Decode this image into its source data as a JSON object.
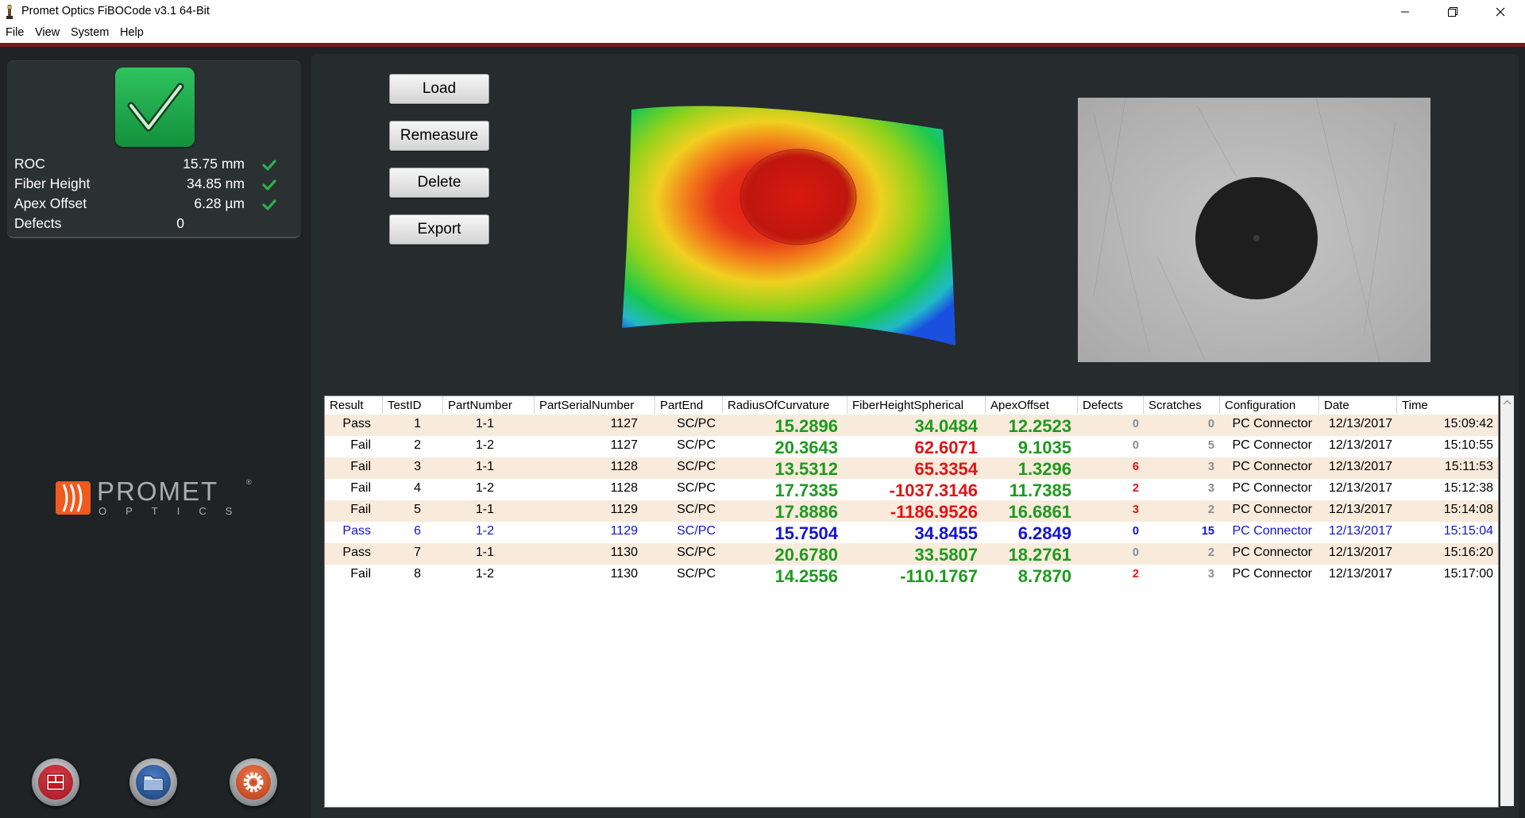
{
  "window": {
    "title": "Promet Optics FiBOCode v3.1 64-Bit"
  },
  "menu": [
    "File",
    "View",
    "System",
    "Help"
  ],
  "status": {
    "metrics": [
      {
        "label": "ROC",
        "value": "15.75 mm",
        "ok": true
      },
      {
        "label": "Fiber Height",
        "value": "34.85 nm",
        "ok": true
      },
      {
        "label": "Apex Offset",
        "value": "6.28 µm",
        "ok": true
      },
      {
        "label": "Defects",
        "value": "0",
        "ok": false
      }
    ]
  },
  "logo": {
    "name": "PROMET",
    "sub": "OPTICS",
    "reg": "®"
  },
  "actions": {
    "load": "Load",
    "remeasure": "Remeasure",
    "delete": "Delete",
    "export": "Export"
  },
  "grid": {
    "columns": [
      "Result",
      "TestID",
      "PartNumber",
      "PartSerialNumber",
      "PartEnd",
      "RadiusOfCurvature",
      "FiberHeightSpherical",
      "ApexOffset",
      "Defects",
      "Scratches",
      "Configuration",
      "Date",
      "Time"
    ],
    "rows": [
      {
        "result": "Pass",
        "test_id": "1",
        "part_number": "1-1",
        "serial": "1127",
        "end": "SC/PC",
        "roc": "15.2896",
        "fiber_height": "34.0484",
        "apex": "12.2523",
        "defects": "0",
        "scratches": "0",
        "config": "PC Connector",
        "date": "12/13/2017",
        "time": "15:09:42"
      },
      {
        "result": "Fail",
        "test_id": "2",
        "part_number": "1-2",
        "serial": "1127",
        "end": "SC/PC",
        "roc": "20.3643",
        "fiber_height": "62.6071",
        "apex": "9.1035",
        "defects": "0",
        "scratches": "5",
        "config": "PC Connector",
        "date": "12/13/2017",
        "time": "15:10:55"
      },
      {
        "result": "Fail",
        "test_id": "3",
        "part_number": "1-1",
        "serial": "1128",
        "end": "SC/PC",
        "roc": "13.5312",
        "fiber_height": "65.3354",
        "apex": "1.3296",
        "defects": "6",
        "scratches": "3",
        "config": "PC Connector",
        "date": "12/13/2017",
        "time": "15:11:53"
      },
      {
        "result": "Fail",
        "test_id": "4",
        "part_number": "1-2",
        "serial": "1128",
        "end": "SC/PC",
        "roc": "17.7335",
        "fiber_height": "-1037.3146",
        "apex": "11.7385",
        "defects": "2",
        "scratches": "3",
        "config": "PC Connector",
        "date": "12/13/2017",
        "time": "15:12:38"
      },
      {
        "result": "Fail",
        "test_id": "5",
        "part_number": "1-1",
        "serial": "1129",
        "end": "SC/PC",
        "roc": "17.8886",
        "fiber_height": "-1186.9526",
        "apex": "16.6861",
        "defects": "3",
        "scratches": "2",
        "config": "PC Connector",
        "date": "12/13/2017",
        "time": "15:14:08"
      },
      {
        "result": "Pass",
        "test_id": "6",
        "part_number": "1-2",
        "serial": "1129",
        "end": "SC/PC",
        "roc": "15.7504",
        "fiber_height": "34.8455",
        "apex": "6.2849",
        "defects": "0",
        "scratches": "15",
        "config": "PC Connector",
        "date": "12/13/2017",
        "time": "15:15:04"
      },
      {
        "result": "Pass",
        "test_id": "7",
        "part_number": "1-1",
        "serial": "1130",
        "end": "SC/PC",
        "roc": "20.6780",
        "fiber_height": "33.5807",
        "apex": "18.2761",
        "defects": "0",
        "scratches": "2",
        "config": "PC Connector",
        "date": "12/13/2017",
        "time": "15:16:20"
      },
      {
        "result": "Fail",
        "test_id": "8",
        "part_number": "1-2",
        "serial": "1130",
        "end": "SC/PC",
        "roc": "14.2556",
        "fiber_height": "-110.1767",
        "apex": "8.7870",
        "defects": "2",
        "scratches": "3",
        "config": "PC Connector",
        "date": "12/13/2017",
        "time": "15:17:00"
      }
    ],
    "selected_row": 5,
    "fail_metrics": {
      "fiber_height": [
        false,
        true,
        true,
        true,
        true,
        false,
        false,
        false
      ],
      "defects": [
        false,
        false,
        true,
        true,
        true,
        false,
        false,
        true
      ]
    }
  },
  "colors": {
    "pass_green": "#1e9a1e",
    "fail_red": "#e01414",
    "selected_blue": "#1414d0",
    "grey_value": "#8c8c8c",
    "alt_row": "#f8ebdc",
    "accent_bar": "#7a1a1d"
  },
  "icons": {
    "status": "check-icon",
    "bottom_buttons": [
      "layout-icon",
      "folder-icon",
      "settings-icon"
    ]
  }
}
